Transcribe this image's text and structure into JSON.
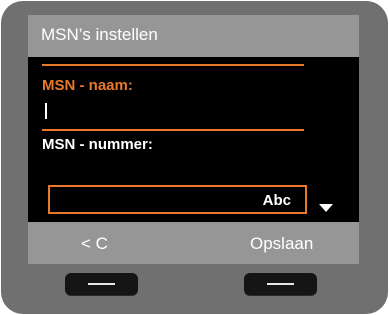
{
  "header": {
    "title": "MSN’s instellen"
  },
  "form": {
    "name_label": "MSN - naam:",
    "name_value": "",
    "number_label": "MSN - nummer:",
    "number_value": "",
    "input_mode": "Abc"
  },
  "softkeys": {
    "left": "< C",
    "right": "Opslaan"
  },
  "colors": {
    "accent": "#e8782a",
    "screen_bg": "#000000",
    "bar_bg": "#969696",
    "bezel": "#707070"
  }
}
